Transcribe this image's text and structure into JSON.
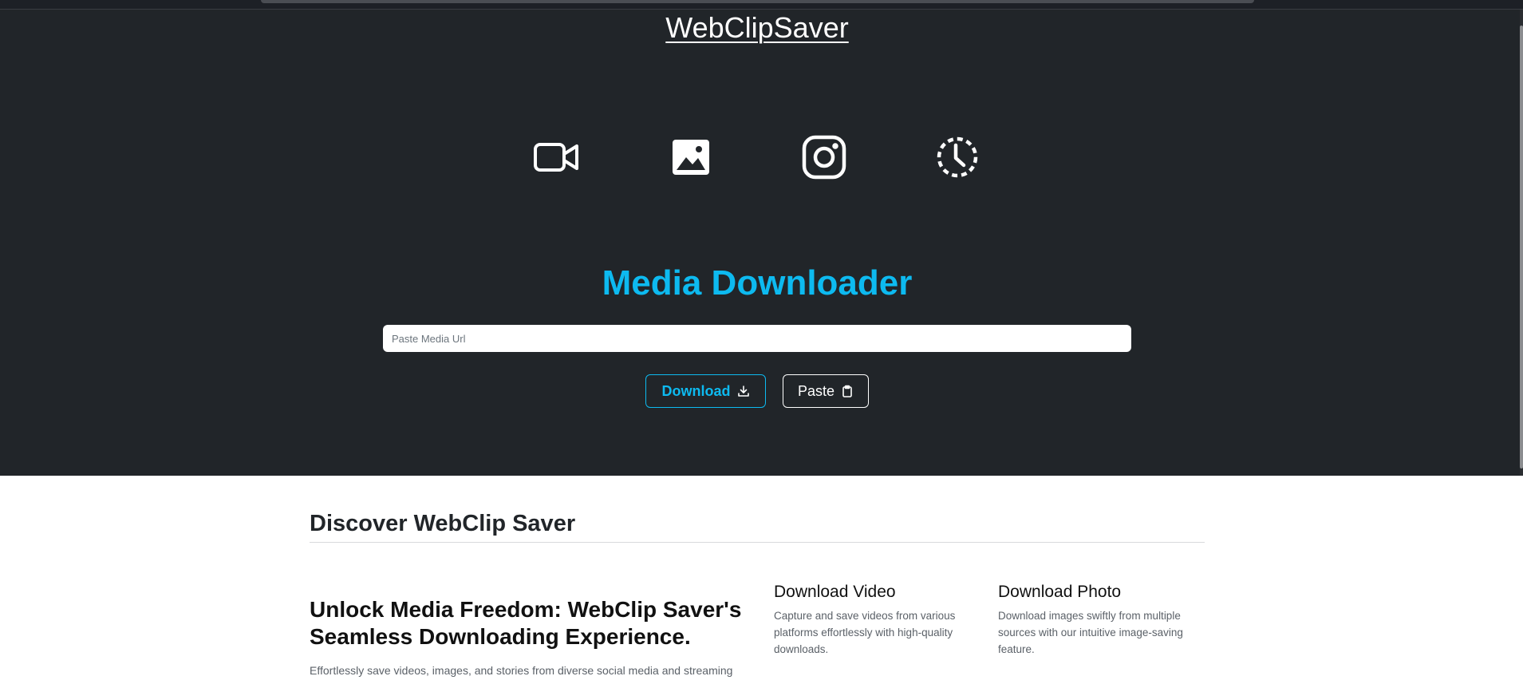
{
  "header": {
    "brand": "WebClipSaver"
  },
  "icons": [
    "video-camera-icon",
    "image-icon",
    "instagram-icon",
    "clock-dashed-icon"
  ],
  "hero": {
    "title": "Media Downloader",
    "url_placeholder": "Paste Media Url",
    "url_value": "",
    "download_label": "Download",
    "paste_label": "Paste"
  },
  "discover": {
    "title": "Discover WebClip Saver",
    "feature_heading": "Unlock Media Freedom: WebClip Saver's Seamless Downloading Experience.",
    "feature_desc": "Effortlessly save videos, images, and stories from diverse social media and streaming",
    "cards": [
      {
        "title": "Download Video",
        "text": "Capture and save videos from various platforms effortlessly with high-quality downloads."
      },
      {
        "title": "Download Photo",
        "text": "Download images swiftly from multiple sources with our intuitive image-saving feature."
      }
    ]
  },
  "colors": {
    "hero_bg": "#212529",
    "accent": "#0dbaf0",
    "white": "#ffffff"
  }
}
